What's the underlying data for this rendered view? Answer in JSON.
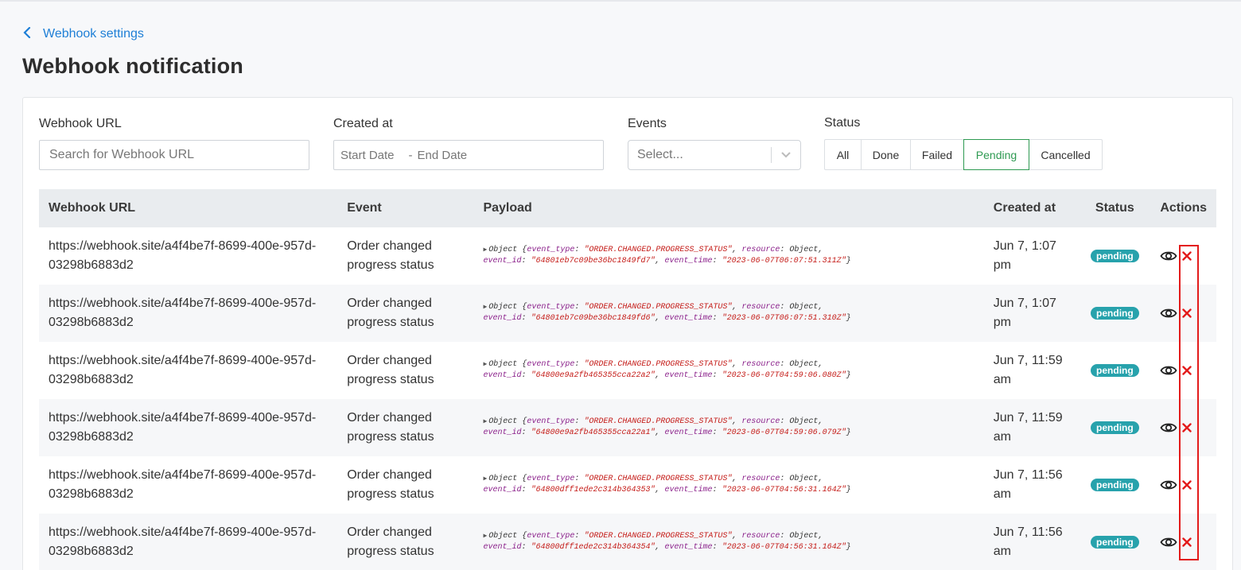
{
  "header": {
    "back_label": "Webhook settings",
    "title": "Webhook notification"
  },
  "filters": {
    "url_label": "Webhook URL",
    "url_placeholder": "Search for Webhook URL",
    "created_label": "Created at",
    "start_placeholder": "Start Date",
    "date_separator": "-",
    "end_placeholder": "End Date",
    "events_label": "Events",
    "events_placeholder": "Select...",
    "status_label": "Status",
    "status_options": [
      "All",
      "Done",
      "Failed",
      "Pending",
      "Cancelled"
    ],
    "status_selected": "Pending"
  },
  "table": {
    "columns": [
      "Webhook URL",
      "Event",
      "Payload",
      "Created at",
      "Status",
      "Actions"
    ],
    "rows": [
      {
        "url": "https://webhook.site/a4f4be7f-8699-400e-957d-03298b6883d2",
        "event": "Order changed progress status",
        "payload": {
          "prefix": "Object",
          "event_type": "\"ORDER.CHANGED.PROGRESS_STATUS\"",
          "resource": "Object",
          "event_id": "\"64801eb7c09be36bc1849fd7\"",
          "event_time": "\"2023-06-07T06:07:51.311Z\""
        },
        "created": "Jun 7, 1:07 pm",
        "status": "pending"
      },
      {
        "url": "https://webhook.site/a4f4be7f-8699-400e-957d-03298b6883d2",
        "event": "Order changed progress status",
        "payload": {
          "prefix": "Object",
          "event_type": "\"ORDER.CHANGED.PROGRESS_STATUS\"",
          "resource": "Object",
          "event_id": "\"64801eb7c09be36bc1849fd6\"",
          "event_time": "\"2023-06-07T06:07:51.310Z\""
        },
        "created": "Jun 7, 1:07 pm",
        "status": "pending"
      },
      {
        "url": "https://webhook.site/a4f4be7f-8699-400e-957d-03298b6883d2",
        "event": "Order changed progress status",
        "payload": {
          "prefix": "Object",
          "event_type": "\"ORDER.CHANGED.PROGRESS_STATUS\"",
          "resource": "Object",
          "event_id": "\"64800e9a2fb465355cca22a2\"",
          "event_time": "\"2023-06-07T04:59:06.080Z\""
        },
        "created": "Jun 7, 11:59 am",
        "status": "pending"
      },
      {
        "url": "https://webhook.site/a4f4be7f-8699-400e-957d-03298b6883d2",
        "event": "Order changed progress status",
        "payload": {
          "prefix": "Object",
          "event_type": "\"ORDER.CHANGED.PROGRESS_STATUS\"",
          "resource": "Object",
          "event_id": "\"64800e9a2fb465355cca22a1\"",
          "event_time": "\"2023-06-07T04:59:06.079Z\""
        },
        "created": "Jun 7, 11:59 am",
        "status": "pending"
      },
      {
        "url": "https://webhook.site/a4f4be7f-8699-400e-957d-03298b6883d2",
        "event": "Order changed progress status",
        "payload": {
          "prefix": "Object",
          "event_type": "\"ORDER.CHANGED.PROGRESS_STATUS\"",
          "resource": "Object",
          "event_id": "\"64800dff1ede2c314b364353\"",
          "event_time": "\"2023-06-07T04:56:31.164Z\""
        },
        "created": "Jun 7, 11:56 am",
        "status": "pending"
      },
      {
        "url": "https://webhook.site/a4f4be7f-8699-400e-957d-03298b6883d2",
        "event": "Order changed progress status",
        "payload": {
          "prefix": "Object",
          "event_type": "\"ORDER.CHANGED.PROGRESS_STATUS\"",
          "resource": "Object",
          "event_id": "\"64800dff1ede2c314b364354\"",
          "event_time": "\"2023-06-07T04:56:31.164Z\""
        },
        "created": "Jun 7, 11:56 am",
        "status": "pending"
      }
    ]
  },
  "icons": {
    "back": "chevron-left-icon",
    "dropdown": "chevron-down-icon",
    "view": "eye-icon",
    "cancel": "close-icon"
  },
  "colors": {
    "link": "#1e7fd6",
    "active_status": "#2e9a52",
    "badge": "#27a2ac",
    "cancel": "#e31b1b"
  }
}
